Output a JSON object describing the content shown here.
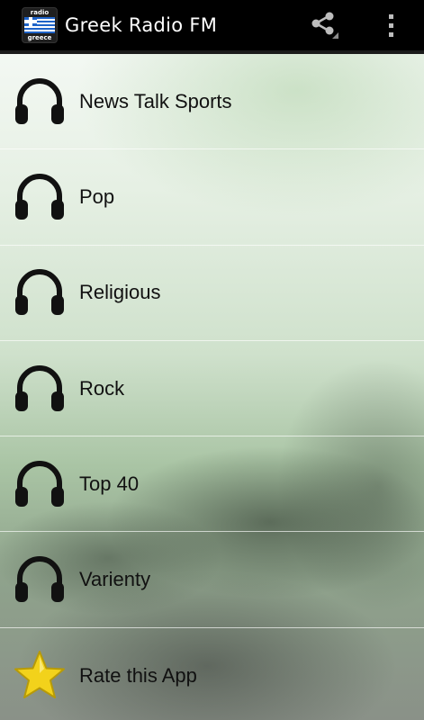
{
  "app": {
    "title": "Greek Radio FM",
    "icon_text_top": "radio",
    "icon_text_bottom": "greece"
  },
  "actions": {
    "share_icon": "share-icon",
    "overflow_icon": "overflow-menu-icon"
  },
  "items": [
    {
      "label": "News Talk Sports",
      "icon": "headphones-icon"
    },
    {
      "label": "Pop",
      "icon": "headphones-icon"
    },
    {
      "label": "Religious",
      "icon": "headphones-icon"
    },
    {
      "label": "Rock",
      "icon": "headphones-icon"
    },
    {
      "label": "Top 40",
      "icon": "headphones-icon"
    },
    {
      "label": "Varienty",
      "icon": "headphones-icon"
    },
    {
      "label": "Rate this App",
      "icon": "star-icon"
    }
  ],
  "colors": {
    "actionbar": "#000000",
    "star": "#f2d21b",
    "text": "#111111"
  }
}
